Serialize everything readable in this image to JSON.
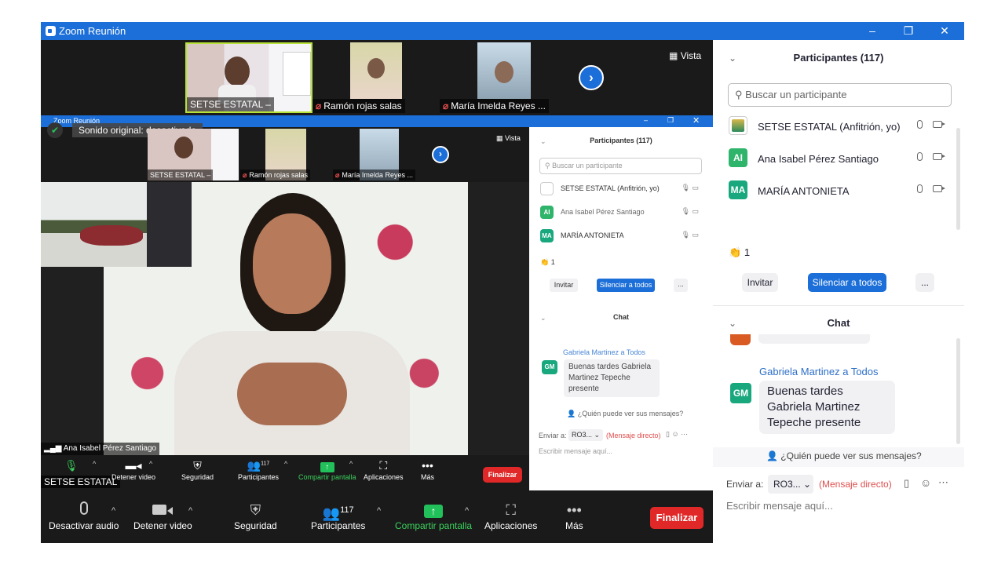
{
  "window": {
    "title": "Zoom Reunión",
    "minimize": "–",
    "restore": "❐",
    "close": "✕"
  },
  "strip": {
    "tiles": [
      {
        "name": "SETSE ESTATAL",
        "suffix": "–",
        "muted": false
      },
      {
        "name": "Ramón rojas salas",
        "muted": true
      },
      {
        "name": "María Imelda Reyes ...",
        "muted": true
      }
    ],
    "next_icon": "›",
    "view_label": "Vista"
  },
  "inner": {
    "title": "Zoom Reunión",
    "audio_notice": "Sonido original: desactivado",
    "view_label": "Vista",
    "tiles": [
      {
        "name": "SETSE ESTATAL",
        "suffix": "–"
      },
      {
        "name": "Ramón rojas salas"
      },
      {
        "name": "María Imelda Reyes ..."
      }
    ],
    "speaker_name": "Ana Isabel Pérez Santiago",
    "toolbar": {
      "overlay_name": "SETSE ESTATAL",
      "video": "Detener video",
      "security": "Seguridad",
      "participants": "Participantes",
      "participants_count": "117",
      "share": "Compartir pantalla",
      "apps": "Aplicaciones",
      "more": "Más",
      "end": "Finalizar"
    },
    "panel": {
      "participants_title": "Participantes (117)",
      "search_placeholder": "Buscar un participante",
      "participants": [
        {
          "initials": "",
          "name": "SETSE ESTATAL (Anfitrión, yo)",
          "color": "#ffffff"
        },
        {
          "initials": "AI",
          "name": "Ana Isabel Pérez Santiago",
          "color": "#2fb46b"
        },
        {
          "initials": "MA",
          "name": "MARÍA ANTONIETA",
          "color": "#19a87e"
        }
      ],
      "reaction": "👏 1",
      "invite": "Invitar",
      "mute_all": "Silenciar a todos",
      "more": "...",
      "chat_title": "Chat",
      "chat_from": "Gabriela Martinez a Todos",
      "chat_initials": "GM",
      "chat_message": "Buenas tardes Gabriela Martinez Tepeche presente",
      "who_can_see": "¿Quién puede ver sus mensajes?",
      "send_to_label": "Enviar a:",
      "send_to_value": "RO3... ⌄",
      "direct": "(Mensaje directo)",
      "placeholder": "Escribir mensaje aquí..."
    }
  },
  "bottom_toolbar": {
    "mute": "Desactivar audio",
    "video": "Detener video",
    "security": "Seguridad",
    "participants": "Participantes",
    "participants_count": "117",
    "share": "Compartir pantalla",
    "apps": "Aplicaciones",
    "more": "Más",
    "end": "Finalizar"
  },
  "side": {
    "participants_title": "Participantes (117)",
    "search_placeholder": "Buscar un participante",
    "participants": [
      {
        "initials": "",
        "name": "SETSE ESTATAL (Anfitrión, yo)",
        "color": "#ffffff"
      },
      {
        "initials": "AI",
        "name": "Ana Isabel Pérez Santiago",
        "color": "#2fb46b"
      },
      {
        "initials": "MA",
        "name": "MARÍA ANTONIETA",
        "color": "#19a87e"
      }
    ],
    "reaction_count": "1",
    "invite": "Invitar",
    "mute_all": "Silenciar a todos",
    "more": "...",
    "chat_title": "Chat",
    "chat_from": "Gabriela Martinez a Todos",
    "chat_initials": "GM",
    "chat_message": "Buenas tardes Gabriela Martinez Tepeche presente",
    "who_can_see": "¿Quién puede ver sus mensajes?",
    "send_to_label": "Enviar a:",
    "send_to_value": "RO3...",
    "direct": "(Mensaje directo)",
    "placeholder": "Escribir mensaje aquí..."
  },
  "colors": {
    "accent": "#1c6fd8",
    "end": "#e02828",
    "share": "#22c05a"
  }
}
